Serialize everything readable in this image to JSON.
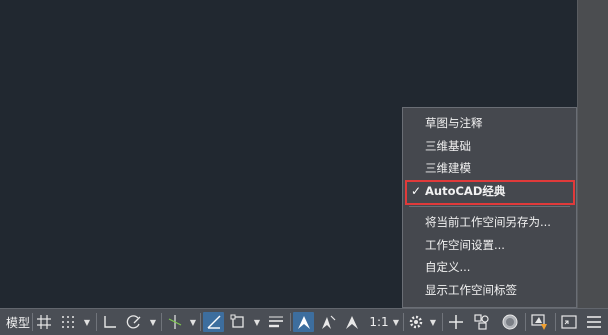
{
  "statusbar": {
    "model_label": "模型",
    "scale_label": "1:1"
  },
  "workspace_menu": {
    "items": [
      {
        "label": "草图与注释",
        "checked": false
      },
      {
        "label": "三维基础",
        "checked": false
      },
      {
        "label": "三维建模",
        "checked": false
      },
      {
        "label": "AutoCAD经典",
        "checked": true
      }
    ],
    "actions": [
      {
        "label": "将当前工作空间另存为..."
      },
      {
        "label": "工作空间设置..."
      },
      {
        "label": "自定义..."
      },
      {
        "label": "显示工作空间标签"
      }
    ],
    "check_mark": "✓",
    "highlight_color": "#e03a3a"
  }
}
